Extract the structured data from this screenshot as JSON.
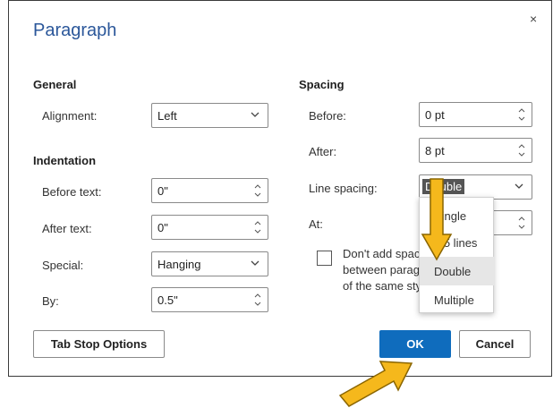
{
  "dialog": {
    "title": "Paragraph",
    "close_glyph": "×"
  },
  "general": {
    "heading": "General",
    "alignment_label": "Alignment:",
    "alignment_value": "Left"
  },
  "indentation": {
    "heading": "Indentation",
    "before_text_label": "Before text:",
    "before_text_value": "0\"",
    "after_text_label": "After text:",
    "after_text_value": "0\"",
    "special_label": "Special:",
    "special_value": "Hanging",
    "by_label": "By:",
    "by_value": "0.5\""
  },
  "spacing": {
    "heading": "Spacing",
    "before_label": "Before:",
    "before_value": "0 pt",
    "after_label": "After:",
    "after_value": "8 pt",
    "line_spacing_label": "Line spacing:",
    "line_spacing_value": "Double",
    "at_label": "At:",
    "options": [
      "Single",
      "1.5 lines",
      "Double",
      "Multiple"
    ],
    "dont_add_space_text": "Don't add space between paragraphs of the same style"
  },
  "buttons": {
    "tab_stop": "Tab Stop Options",
    "ok": "OK",
    "cancel": "Cancel"
  },
  "colors": {
    "title": "#2b579a",
    "primary_button": "#0f6cbd",
    "annotation_arrow": "#f5b81c"
  }
}
